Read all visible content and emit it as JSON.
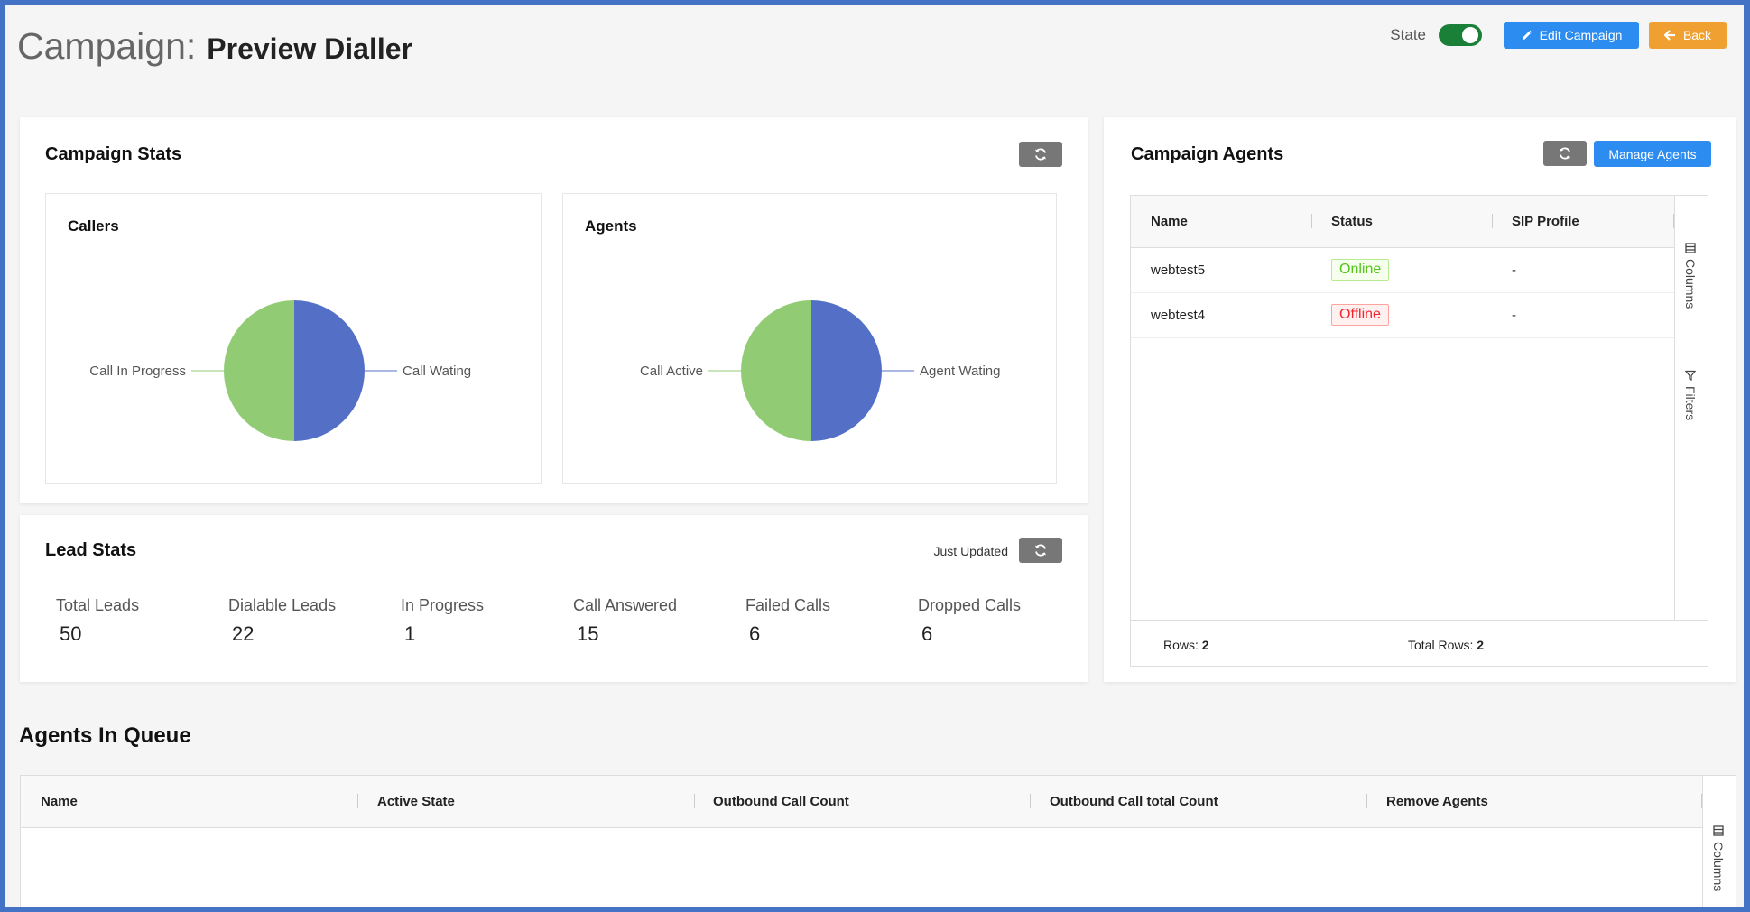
{
  "header": {
    "title_prefix": "Campaign:",
    "title_name": "Preview Dialler",
    "state_label": "State",
    "state_on": true,
    "edit_label": "Edit Campaign",
    "back_label": "Back"
  },
  "campaign_stats": {
    "title": "Campaign Stats"
  },
  "chart_data": [
    {
      "type": "pie",
      "title": "Callers",
      "slices": [
        {
          "label": "Call Wating",
          "value": 50,
          "color": "#5470c6"
        },
        {
          "label": "Call In Progress",
          "value": 50,
          "color": "#91cc75"
        }
      ]
    },
    {
      "type": "pie",
      "title": "Agents",
      "slices": [
        {
          "label": "Agent Wating",
          "value": 50,
          "color": "#5470c6"
        },
        {
          "label": "Call Active",
          "value": 50,
          "color": "#91cc75"
        }
      ]
    }
  ],
  "lead_stats": {
    "title": "Lead Stats",
    "updated_text": "Just Updated",
    "items": [
      {
        "label": "Total Leads",
        "value": "50"
      },
      {
        "label": "Dialable Leads",
        "value": "22"
      },
      {
        "label": "In Progress",
        "value": "1"
      },
      {
        "label": "Call Answered",
        "value": "15"
      },
      {
        "label": "Failed Calls",
        "value": "6"
      },
      {
        "label": "Dropped Calls",
        "value": "6"
      }
    ]
  },
  "campaign_agents": {
    "title": "Campaign Agents",
    "manage_label": "Manage Agents",
    "columns": [
      "Name",
      "Status",
      "SIP Profile"
    ],
    "rows": [
      {
        "name": "webtest5",
        "status": "Online",
        "sip": "-"
      },
      {
        "name": "webtest4",
        "status": "Offline",
        "sip": "-"
      }
    ],
    "side_columns": "Columns",
    "side_filters": "Filters",
    "rows_label": "Rows:",
    "rows_value": "2",
    "total_label": "Total Rows:",
    "total_value": "2"
  },
  "agents_in_queue": {
    "title": "Agents In Queue",
    "columns": [
      "Name",
      "Active State",
      "Outbound Call Count",
      "Outbound Call total Count",
      "Remove Agents"
    ],
    "side_columns": "Columns"
  }
}
